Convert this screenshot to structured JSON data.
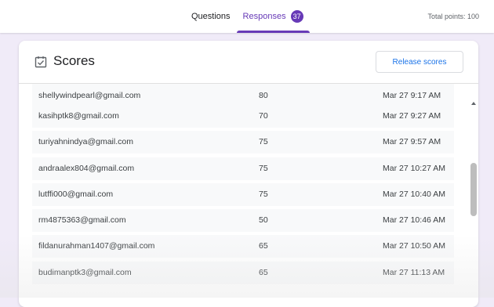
{
  "tabs": [
    {
      "label": "Questions",
      "active": false
    },
    {
      "label": "Responses",
      "active": true,
      "badge": "37"
    }
  ],
  "total_points": "Total points: 100",
  "card": {
    "title": "Scores",
    "icon": "checkbox-list-icon",
    "release_button": "Release scores"
  },
  "responses": [
    {
      "email": "shellywindpearl@gmail.com",
      "score": "80",
      "time": "Mar 27 9:17 AM"
    },
    {
      "email": "kasihptk8@gmail.com",
      "score": "70",
      "time": "Mar 27 9:27 AM"
    },
    {
      "email": "turiyahnindya@gmail.com",
      "score": "75",
      "time": "Mar 27 9:57 AM"
    },
    {
      "email": "andraalex804@gmail.com",
      "score": "75",
      "time": "Mar 27 10:27 AM"
    },
    {
      "email": "lutffi000@gmail.com",
      "score": "75",
      "time": "Mar 27 10:40 AM"
    },
    {
      "email": "rm4875363@gmail.com",
      "score": "50",
      "time": "Mar 27 10:46 AM"
    },
    {
      "email": "fildanurahman1407@gmail.com",
      "score": "65",
      "time": "Mar 27 10:50 AM"
    },
    {
      "email": "budimanptk3@gmail.com",
      "score": "65",
      "time": "Mar 27 11:13 AM"
    }
  ],
  "colors": {
    "accent": "#673ab7",
    "link_blue": "#1a73e8",
    "page_bg": "#f0ebf8",
    "row_bg": "#f8f9fa"
  }
}
